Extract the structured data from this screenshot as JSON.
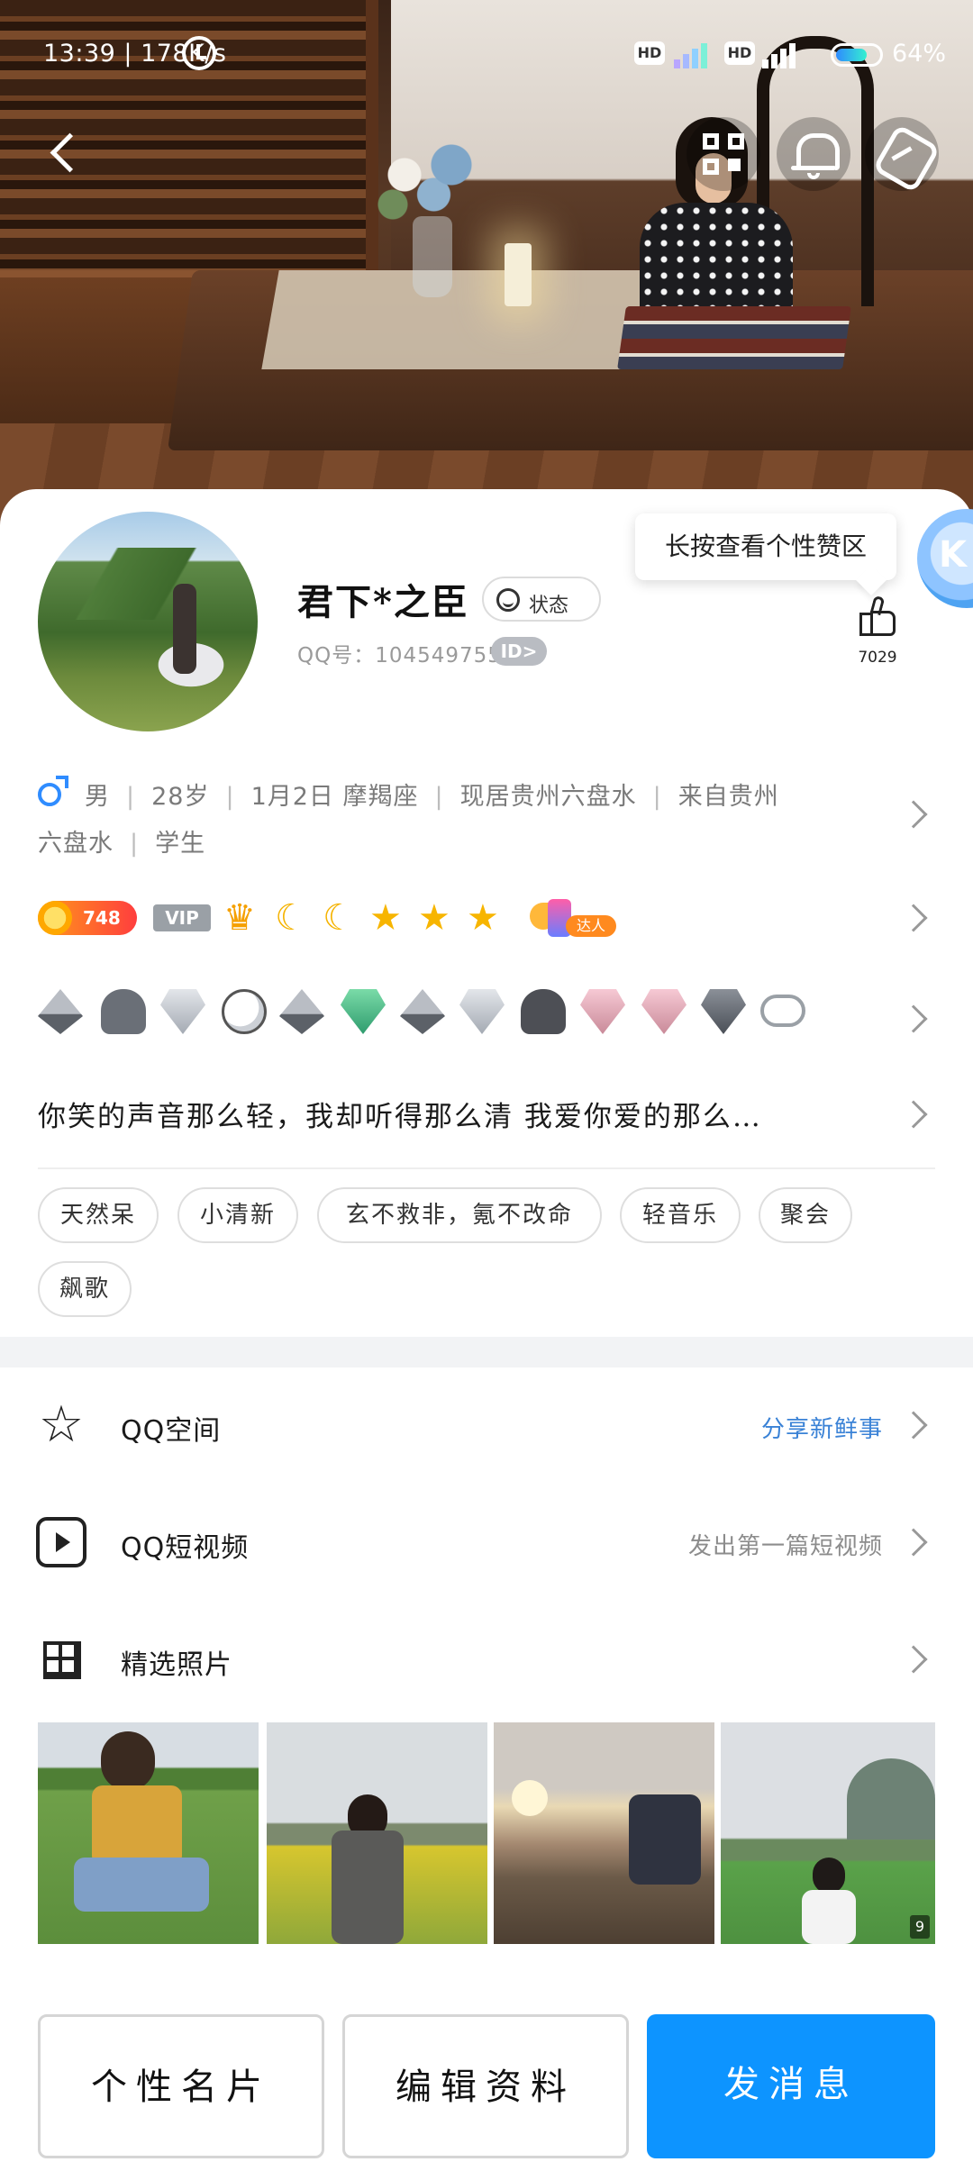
{
  "status_bar": {
    "time_speed": "13:39 | 178K/s",
    "hd_1": "HD",
    "hd_2": "HD",
    "battery": "64%"
  },
  "profile": {
    "nickname": "君下*之臣",
    "status_label": "状态",
    "qq_number": "QQ号：1045497550",
    "id_badge": "ID>",
    "tooltip": "长按查看个性赞区",
    "vip_circle_letter": "K",
    "likes": "7029",
    "info_line_1": [
      "男",
      "28岁",
      "1月2日  摩羯座",
      "现居贵州六盘水",
      "来自贵州"
    ],
    "info_line_2": [
      "六盘水",
      "学生"
    ],
    "level_value": "748",
    "vip_label": "VIP",
    "level_icons": [
      "crown",
      "moon",
      "moon",
      "star",
      "star",
      "star"
    ],
    "daren_label": "达人",
    "signature": "你笑的声音那么轻，我却听得那么清     我爱你爱的那么…",
    "tags": [
      "天然呆",
      "小清新",
      "玄不救非，氪不改命",
      "轻音乐",
      "聚会",
      "飙歌"
    ]
  },
  "rows": [
    {
      "icon": "star-icon",
      "label": "QQ空间",
      "right": "分享新鲜事",
      "right_color": "#3a82d6"
    },
    {
      "icon": "video-icon",
      "label": "QQ短视频",
      "right": "发出第一篇短视频",
      "right_color": "#8c8c8c"
    },
    {
      "icon": "grid-icon",
      "label": "精选照片",
      "right": ""
    }
  ],
  "photos": {
    "count": "9"
  },
  "buttons": {
    "card": "个性名片",
    "edit": "编辑资料",
    "message": "发消息"
  },
  "colors": {
    "accent": "#0d94ff",
    "link": "#3a82d6"
  }
}
